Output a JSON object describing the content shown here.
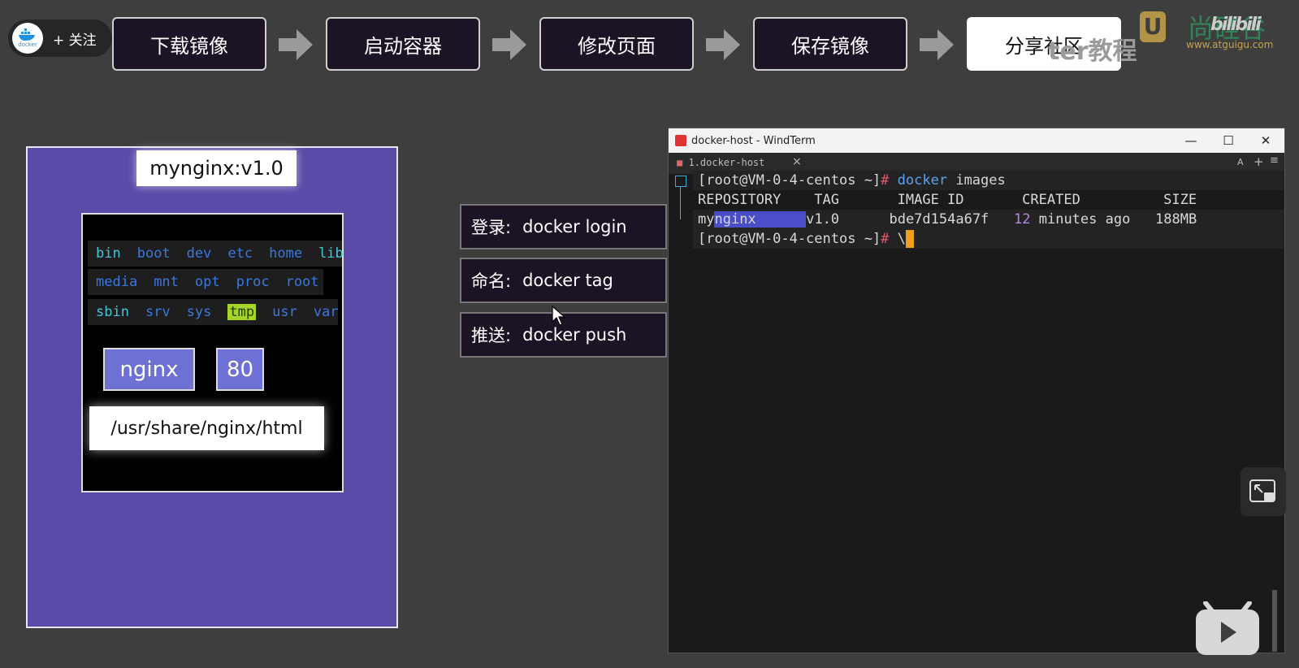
{
  "top": {
    "follow_label": "+ 关注",
    "logo_text": "docker",
    "steps": [
      "下载镜像",
      "启动容器",
      "修改页面",
      "保存镜像",
      "分享社区"
    ],
    "active_step": 4
  },
  "watermark": {
    "text": "ter教程",
    "logo_letter": "U",
    "brand": "尚硅谷",
    "url": "www.atguigu.com",
    "site": "bilibili"
  },
  "diagram": {
    "image_label": "mynginx:v1.0",
    "fs_rows": [
      [
        {
          "t": "bin",
          "c": "cyan"
        },
        {
          "t": "boot",
          "c": "blue"
        },
        {
          "t": "dev",
          "c": "blue"
        },
        {
          "t": "etc",
          "c": "blue"
        },
        {
          "t": "home",
          "c": "blue"
        },
        {
          "t": "lib",
          "c": "cyan"
        }
      ],
      [
        {
          "t": "media",
          "c": "blue"
        },
        {
          "t": "mnt",
          "c": "blue"
        },
        {
          "t": "opt",
          "c": "blue"
        },
        {
          "t": "proc",
          "c": "blue"
        },
        {
          "t": "root",
          "c": "blue"
        }
      ],
      [
        {
          "t": "sbin",
          "c": "cyan"
        },
        {
          "t": "srv",
          "c": "blue"
        },
        {
          "t": "sys",
          "c": "blue"
        },
        {
          "t": "tmp",
          "c": "tmp"
        },
        {
          "t": "usr",
          "c": "blue"
        },
        {
          "t": "var",
          "c": "blue"
        }
      ]
    ],
    "app": "nginx",
    "port": "80",
    "path": "/usr/share/nginx/html"
  },
  "commands": [
    {
      "label": "登录:",
      "cmd": "docker login"
    },
    {
      "label": "命名:",
      "cmd": "docker tag"
    },
    {
      "label": "推送:",
      "cmd": "docker push"
    }
  ],
  "terminal": {
    "window_title": "docker-host - WindTerm",
    "tab": "1.docker-host",
    "tab_close": "×",
    "tb_font": "A",
    "tb_plus": "+",
    "tb_menu": "≡",
    "prompt": "[root@VM-0-4-centos ~]",
    "hash": "#",
    "cmd1_a": "docker",
    "cmd1_b": " images",
    "header": "REPOSITORY    TAG       IMAGE ID       CREATED          SIZE",
    "row_repo_a": "my",
    "row_repo_b": "nginx",
    "row_tag": "v1.0",
    "row_id": "bde7d154a67f",
    "row_created_num": "12",
    "row_created_rest": " minutes ago",
    "row_size": "188MB",
    "line3_tail": " \\",
    "win_min": "—",
    "win_max": "☐",
    "win_close": "✕"
  }
}
